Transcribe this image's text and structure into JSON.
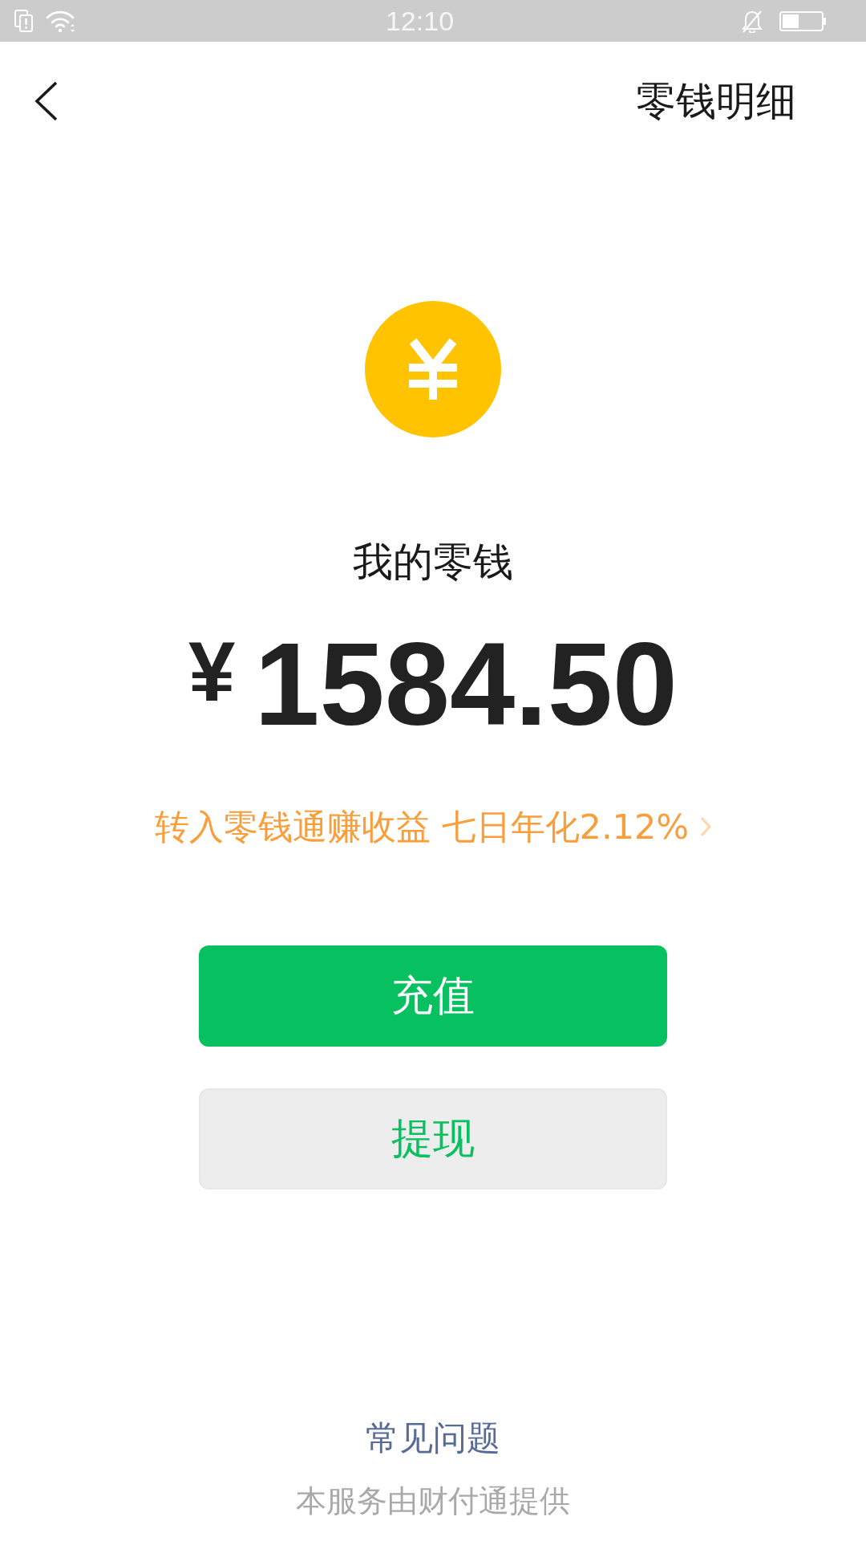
{
  "status_bar": {
    "time": "12:10"
  },
  "header": {
    "title": "零钱明细"
  },
  "balance": {
    "label": "我的零钱",
    "currency": "¥",
    "amount": "1584.50"
  },
  "promo": {
    "text": "转入零钱通赚收益 七日年化2.12%"
  },
  "buttons": [
    {
      "label": "充值",
      "kind": "primary"
    },
    {
      "label": "提现",
      "kind": "secondary"
    }
  ],
  "footer": {
    "link": "常见问题",
    "note": "本服务由财付通提供"
  }
}
